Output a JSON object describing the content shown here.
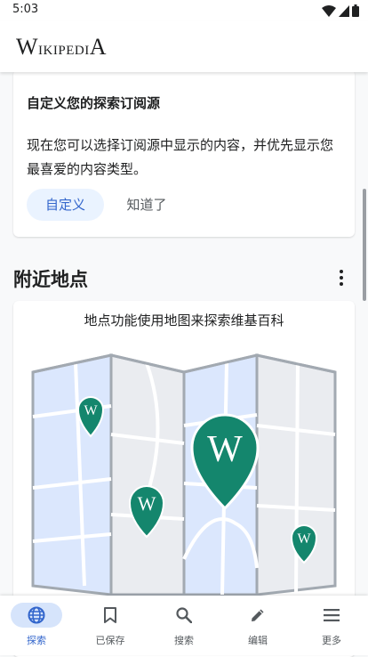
{
  "status_bar": {
    "time": "5:03"
  },
  "app_bar": {
    "wordmark_first": "W",
    "wordmark_mid": "ikipedi",
    "wordmark_last": "A"
  },
  "customize_card": {
    "title": "自定义您的探索订阅源",
    "body": "现在您可以选择订阅源中显示的内容，并优先显示您最喜爱的内容类型。",
    "customize_label": "自定义",
    "got_it_label": "知道了"
  },
  "places_section": {
    "title": "附近地点",
    "card_text": "地点功能使用地图来探索维基百科",
    "pin_letter": "W"
  },
  "bottom_nav": {
    "items": [
      {
        "label": "探索",
        "icon": "globe-icon",
        "active": true
      },
      {
        "label": "已保存",
        "icon": "bookmark-icon",
        "active": false
      },
      {
        "label": "搜索",
        "icon": "search-icon",
        "active": false
      },
      {
        "label": "编辑",
        "icon": "pencil-icon",
        "active": false
      },
      {
        "label": "更多",
        "icon": "menu-icon",
        "active": false
      }
    ]
  },
  "colors": {
    "accent": "#3366cc",
    "pin_green": "#14866d",
    "map_water": "#dbe7fd",
    "map_frame": "#a2a9b1"
  }
}
